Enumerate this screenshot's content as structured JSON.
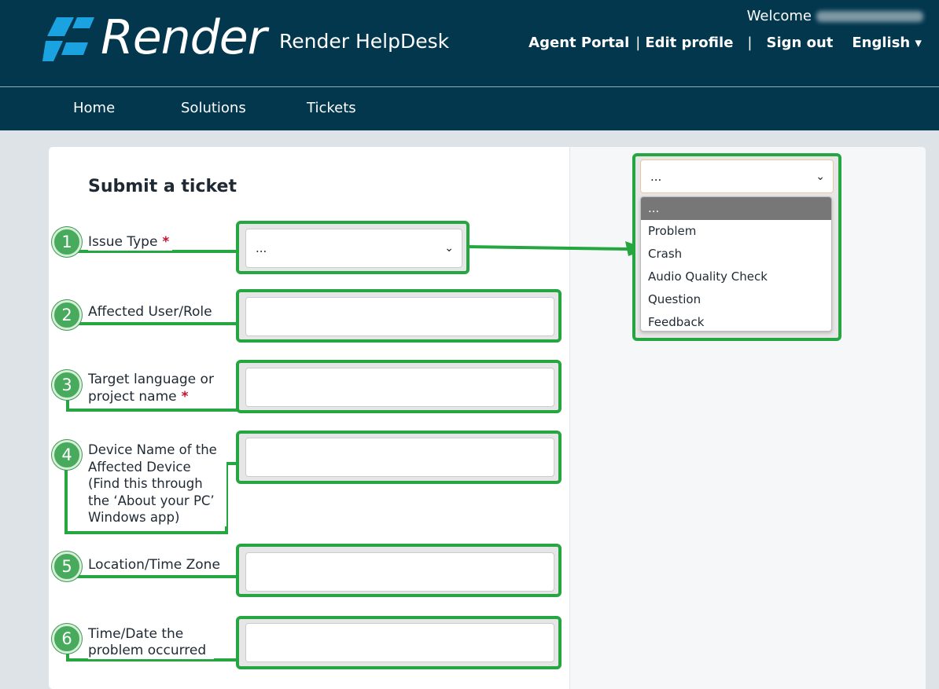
{
  "header": {
    "brand": "Render",
    "site_title": "Render HelpDesk",
    "welcome": "Welcome",
    "links": {
      "agent_portal": "Agent Portal",
      "edit_profile": "Edit profile",
      "sign_out": "Sign out",
      "language": "English"
    },
    "separators": {
      "a": "|",
      "b": "|"
    }
  },
  "nav": {
    "items": [
      "Home",
      "Solutions",
      "Tickets"
    ]
  },
  "form": {
    "title": "Submit a ticket",
    "required_mark": "*",
    "fields": [
      {
        "badge": "1",
        "label": "Issue Type",
        "required": true,
        "value": "..."
      },
      {
        "badge": "2",
        "label": "Affected User/Role",
        "required": false
      },
      {
        "badge": "3",
        "label": "Target language or project name",
        "required": true
      },
      {
        "badge": "4",
        "label": "Device Name of the Affected Device (Find this through the ‘About your PC’ Windows app)",
        "required": false
      },
      {
        "badge": "5",
        "label": "Location/Time Zone",
        "required": false
      },
      {
        "badge": "6",
        "label": "Time/Date the problem occurred",
        "required": false
      }
    ]
  },
  "dropdown": {
    "selected": "...",
    "options": [
      "...",
      "Problem",
      "Crash",
      "Audio Quality Check",
      "Question",
      "Feedback"
    ]
  },
  "colors": {
    "header_bg": "#02374e",
    "highlight_green": "#25a640",
    "required_red": "#c8102e"
  }
}
